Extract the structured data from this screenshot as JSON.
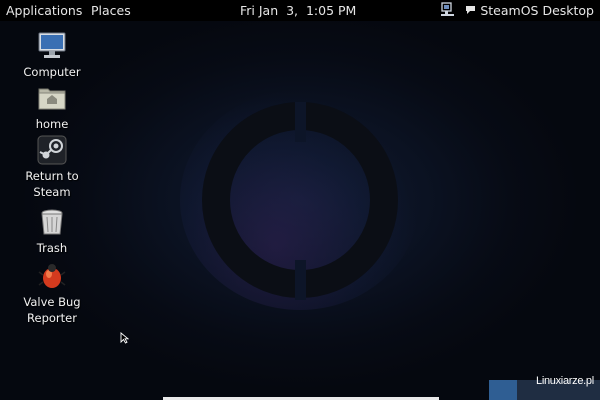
{
  "top_panel": {
    "applications_label": "Applications",
    "places_label": "Places",
    "clock": "Fri Jan  3,  1:05 PM",
    "user_label": "SteamOS Desktop",
    "icons": {
      "network": "network-wired-icon",
      "user": "user-chat-icon"
    }
  },
  "desktop_icons": [
    {
      "label": "Computer",
      "icon": "computer-icon"
    },
    {
      "label": "home",
      "icon": "home-folder-icon"
    },
    {
      "label": "Return to\nSteam",
      "icon": "steam-icon"
    },
    {
      "label": "Trash",
      "icon": "trash-icon"
    },
    {
      "label": "Valve Bug\nReporter",
      "icon": "bug-icon"
    }
  ],
  "watermark": "Linuxiarze.pl",
  "colors": {
    "panel": "#000000",
    "background": "#070b15",
    "logo_ring": "#0c0f16",
    "workspace_active": "#2f5e93"
  }
}
